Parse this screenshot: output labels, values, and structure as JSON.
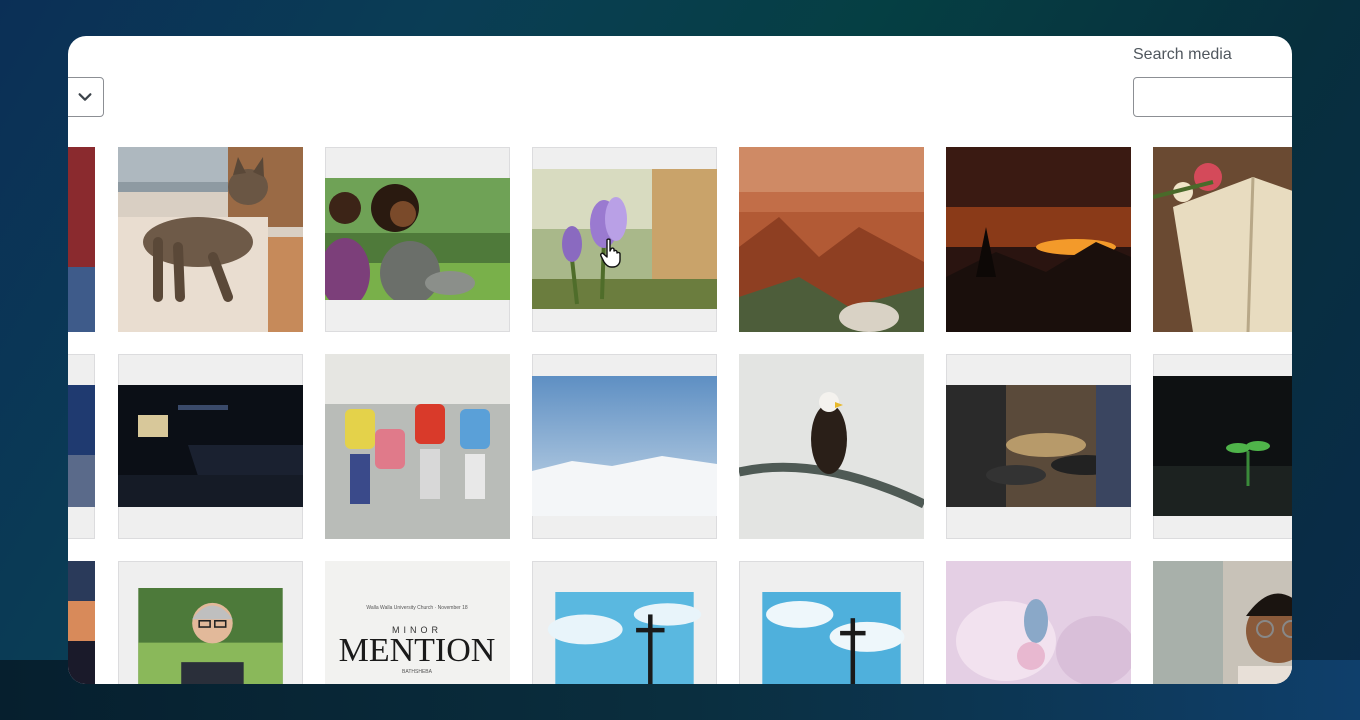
{
  "toolbar": {
    "filter_select": {
      "icon": "chevron-down-icon"
    },
    "search": {
      "label": "Search media",
      "value": "",
      "placeholder": ""
    }
  },
  "media_grid": {
    "rows": [
      [
        "partial-red-image",
        "tabby-cat-on-couch",
        "two-women-smiling-in-park",
        "purple-crocus-flower",
        "red-rock-canyon",
        "sunset-over-mountains",
        "open-book-with-roses"
      ],
      [
        "partial-stage-image",
        "church-stage-dark",
        "children-with-backpacks",
        "snowy-landscape-blue-sky",
        "bald-eagle-on-branch",
        "people-serving-food",
        "seedling-in-dark-soil"
      ],
      [
        "partial-sunset-image",
        "man-with-glasses-portrait",
        "minor-mention-poster",
        "cross-against-sky",
        "cross-against-clouds",
        "blue-butterfly-on-flower",
        "smiling-man-with-glasses"
      ]
    ],
    "poster_text": {
      "small": "Walla Walla University Church · November 18",
      "minor": "MINOR",
      "mention": "MENTION",
      "subtitle": "BATHSHEBA"
    }
  },
  "colors": {
    "accent": "#2271b1",
    "border": "#8c8f94",
    "tile_bg": "#efefef"
  }
}
